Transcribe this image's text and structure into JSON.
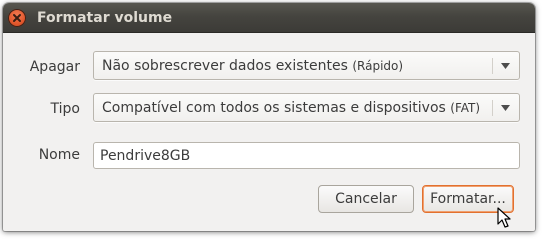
{
  "window": {
    "title": "Formatar volume"
  },
  "form": {
    "erase": {
      "label": "Apagar",
      "value": "Não sobrescrever dados existentes",
      "hint": "(Rápido)"
    },
    "type": {
      "label": "Tipo",
      "value": "Compatível com todos os sistemas e dispositivos",
      "hint": "(FAT)"
    },
    "name": {
      "label": "Nome",
      "value": "Pendrive8GB"
    }
  },
  "buttons": {
    "cancel": "Cancelar",
    "format": "Formatar..."
  },
  "colors": {
    "accent": "#e2712f",
    "titlebar": "#3c3b37",
    "close": "#e2582d",
    "background": "#f2f1f0"
  },
  "icons": {
    "close": "close-icon",
    "dropdown": "chevron-down-icon",
    "cursor": "mouse-pointer-icon"
  }
}
